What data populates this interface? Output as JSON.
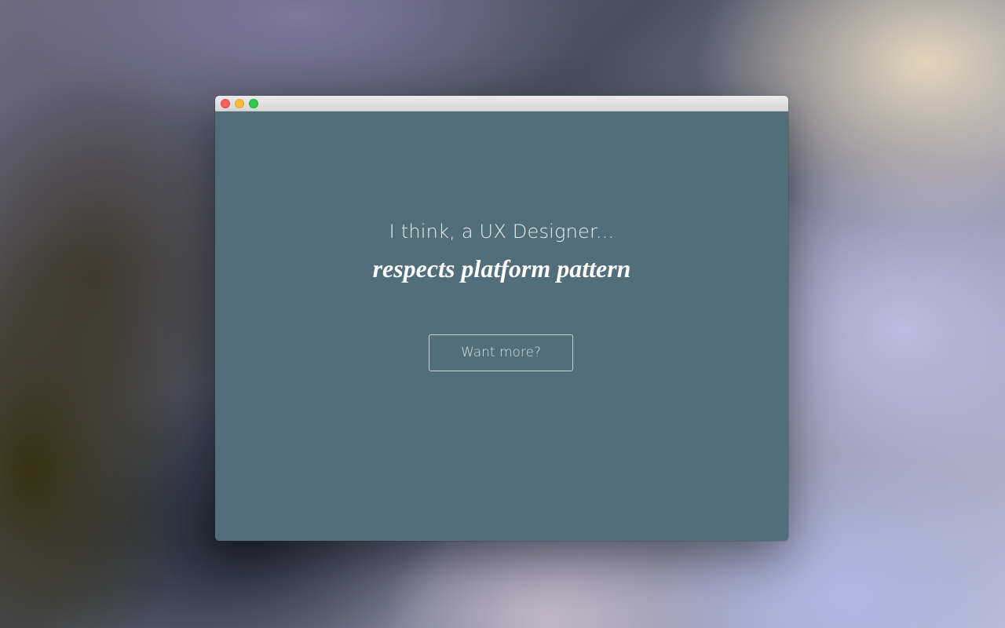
{
  "window": {
    "controls": {
      "close": "close-icon",
      "minimize": "minimize-icon",
      "zoom": "zoom-icon"
    }
  },
  "main": {
    "intro": "I think, a UX Designer...",
    "headline": "respects platform pattern",
    "cta_label": "Want more?"
  },
  "colors": {
    "content_background": "#516e7a",
    "traffic_close": "#fc605c",
    "traffic_minimize": "#fdbc40",
    "traffic_zoom": "#34c84a"
  }
}
